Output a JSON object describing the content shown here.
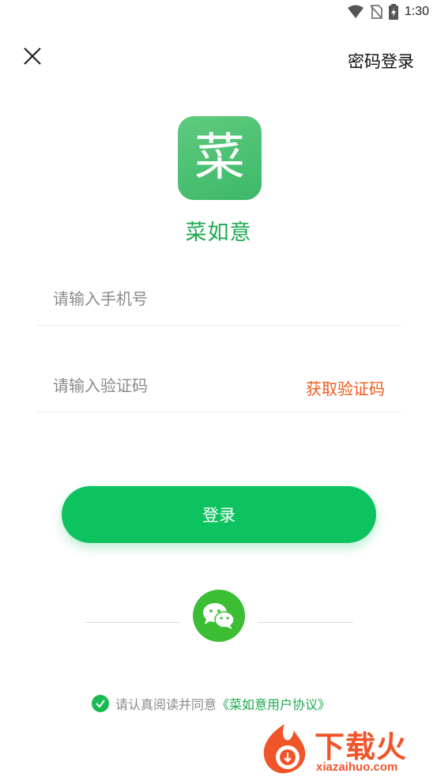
{
  "status_bar": {
    "time": "1:30"
  },
  "header": {
    "password_login_label": "密码登录"
  },
  "logo": {
    "glyph": "菜"
  },
  "app_name": "菜如意",
  "phone_field": {
    "placeholder": "请输入手机号",
    "value": ""
  },
  "code_field": {
    "placeholder": "请输入验证码",
    "value": "",
    "get_code_label": "获取验证码"
  },
  "login_button": {
    "label": "登录"
  },
  "agreement": {
    "text": "请认真阅读并同意",
    "link": "《菜如意用户协议》",
    "checked": true
  },
  "watermark": {
    "text": "下载火",
    "sub": "xiazaihuo.com"
  },
  "colors": {
    "brand_green": "#0cc35f",
    "logo_green": "#4cc372",
    "accent_orange": "#f05a1a",
    "wechat_green": "#3bbd34"
  }
}
